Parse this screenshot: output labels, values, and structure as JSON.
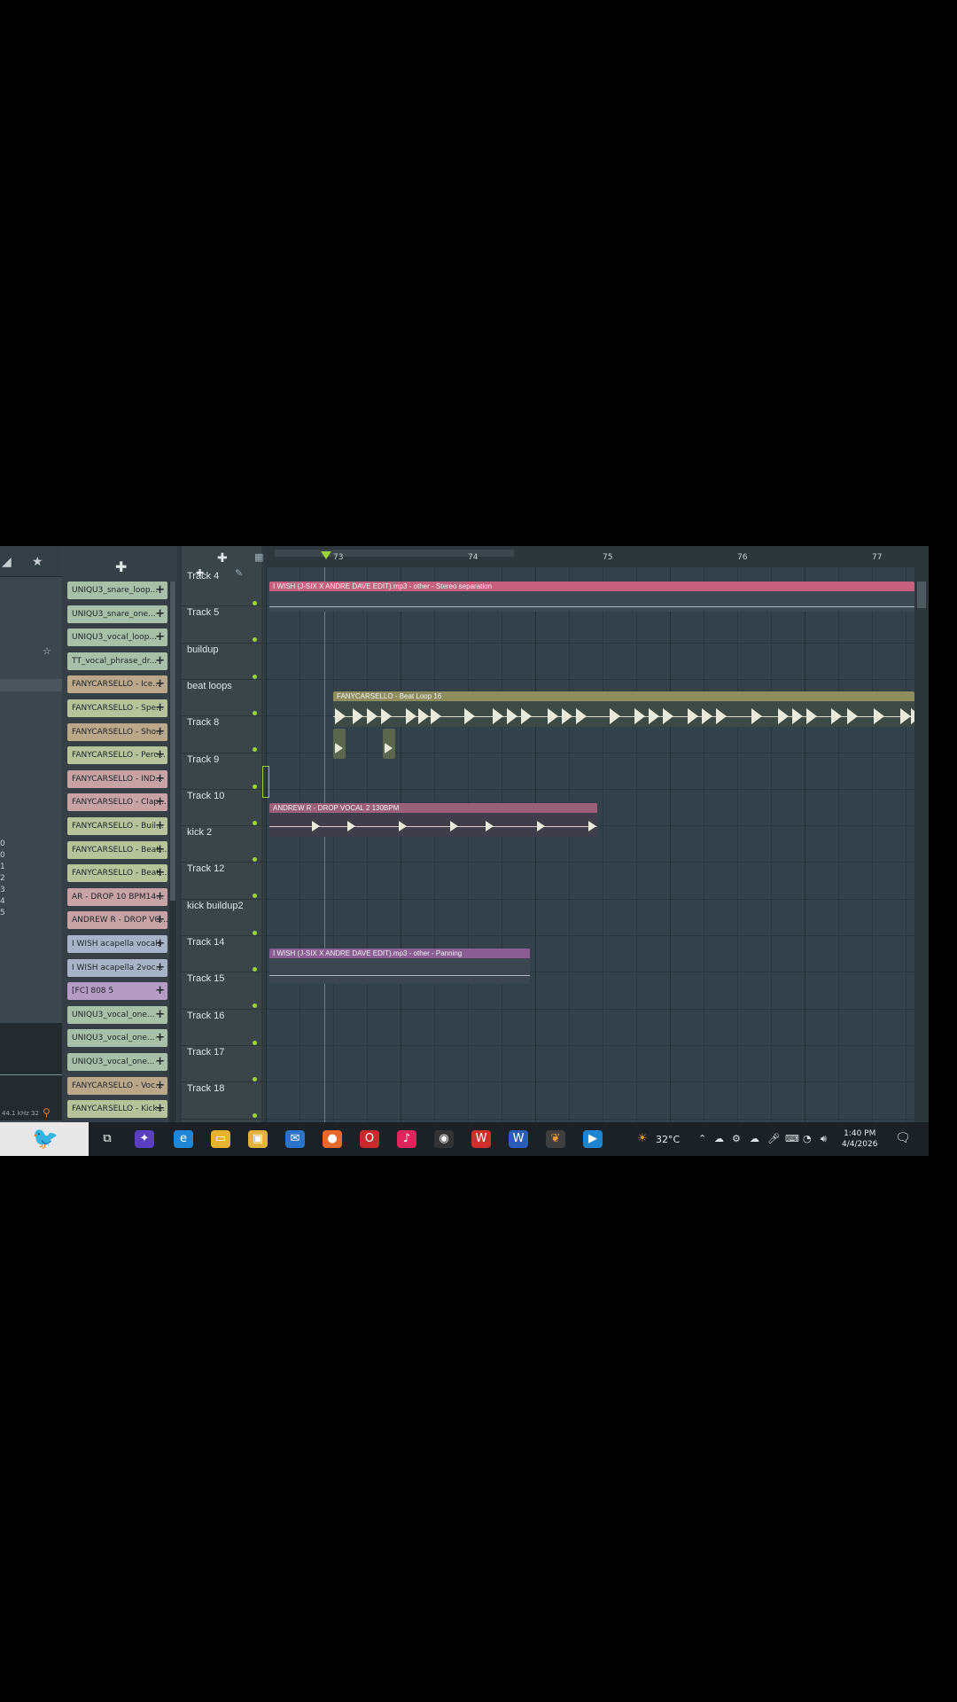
{
  "channels": [
    {
      "label": "UNIQU3_snare_loop...",
      "color": "#a8c0a8"
    },
    {
      "label": "UNIQU3_snare_one...",
      "color": "#a8c0a8"
    },
    {
      "label": "UNIQU3_vocal_loop...",
      "color": "#a8c0a8"
    },
    {
      "label": "TT_vocal_phrase_dr...",
      "color": "#a8c0a8"
    },
    {
      "label": "FANYCARSELLO - Ice...",
      "color": "#bba88a"
    },
    {
      "label": "FANYCARSELLO - Spe...",
      "color": "#b7c39a"
    },
    {
      "label": "FANYCARSELLO - Sho...",
      "color": "#bba88a"
    },
    {
      "label": "FANYCARSELLO - Perc...",
      "color": "#b7c39a"
    },
    {
      "label": "FANYCARSELLO - IND...",
      "color": "#c7a3a6"
    },
    {
      "label": "FANYCARSELLO - Clap...",
      "color": "#c7a3a6"
    },
    {
      "label": "FANYCARSELLO - Buil...",
      "color": "#b7c39a"
    },
    {
      "label": "FANYCARSELLO - Beat...",
      "color": "#b7c39a"
    },
    {
      "label": "FANYCARSELLO - Beat...",
      "color": "#b7c39a"
    },
    {
      "label": "AR - DROP 10 BPM14...",
      "color": "#c7a3a6"
    },
    {
      "label": "ANDREW R - DROP VO...",
      "color": "#c7a3a6"
    },
    {
      "label": "I WISH acapella vocals",
      "color": "#a8b3c7"
    },
    {
      "label": "I WISH acapella 2voc...",
      "color": "#a8b3c7"
    },
    {
      "label": "[FC] 808 5",
      "color": "#b49cc4"
    },
    {
      "label": "UNIQU3_vocal_one...",
      "color": "#a8c0a8"
    },
    {
      "label": "UNIQU3_vocal_one...",
      "color": "#a8c0a8"
    },
    {
      "label": "UNIQU3_vocal_one...",
      "color": "#a8c0a8"
    },
    {
      "label": "FANYCARSELLO - Voc...",
      "color": "#bba88a"
    },
    {
      "label": "FANYCARSELLO - Kick...",
      "color": "#b7c39a"
    }
  ],
  "tracks": [
    "Track 4",
    "Track 5",
    "buildup",
    "beat loops",
    "Track 8",
    "Track 9",
    "Track 10",
    "kick 2",
    "Track 12",
    "kick buildup2",
    "Track 14",
    "Track 15",
    "Track 16",
    "Track 17",
    "Track 18"
  ],
  "ruler_ticks": [
    "73",
    "74",
    "75",
    "76",
    "77"
  ],
  "clips": {
    "stereo_sep": {
      "title": "I WISH (J-SIX X ANDRE DAVE EDIT).mp3 - other - Stereo separation",
      "color": "#c7607e"
    },
    "beat_loop": {
      "title": "FANYCARSELLO - Beat Loop 16",
      "color": "#8f8d5e"
    },
    "drop_vocal": {
      "title": "ANDREW R - DROP VOCAL 2 130BPM",
      "color": "#9a5f79"
    },
    "panning": {
      "title": "I WISH (J-SIX X ANDRE DAVE EDIT).mp3 - other - Panning",
      "color": "#8a5e93"
    }
  },
  "left_panel": {
    "numbers": "0\n0\n1\n2\n3\n4\n5",
    "readout": "44.1 kHz 32"
  },
  "taskbar": {
    "weather": "32°C",
    "time": "1:40 PM",
    "date": "4/4/2026"
  }
}
